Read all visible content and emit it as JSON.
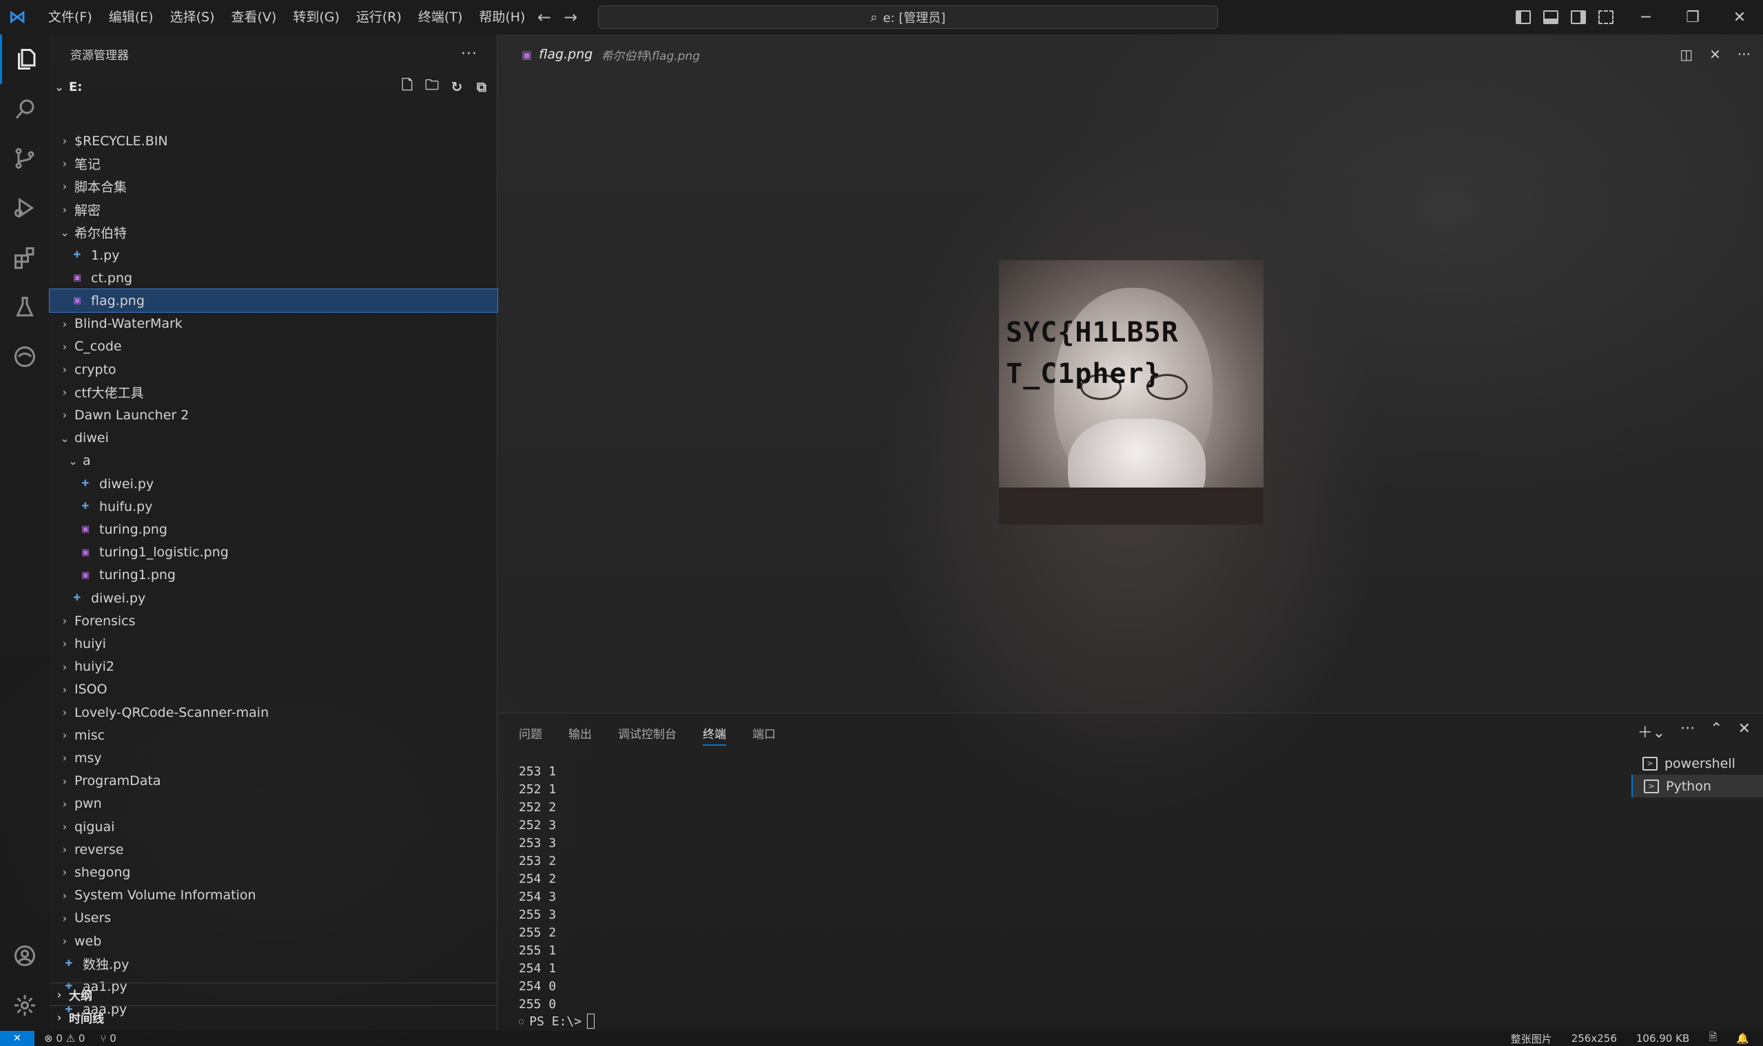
{
  "titlebar": {
    "menu": [
      "文件(F)",
      "编辑(E)",
      "选择(S)",
      "查看(V)",
      "转到(G)",
      "运行(R)",
      "终端(T)",
      "帮助(H)"
    ],
    "search_text": "e: [管理员]"
  },
  "explorer": {
    "title": "资源管理器",
    "root": "E:",
    "items": [
      {
        "label": "$RECYCLE.BIN",
        "type": "folder",
        "depth": 0,
        "expanded": false
      },
      {
        "label": "笔记",
        "type": "folder",
        "depth": 0,
        "expanded": false
      },
      {
        "label": "脚本合集",
        "type": "folder",
        "depth": 0,
        "expanded": false
      },
      {
        "label": "解密",
        "type": "folder",
        "depth": 0,
        "expanded": false
      },
      {
        "label": "希尔伯特",
        "type": "folder",
        "depth": 0,
        "expanded": true
      },
      {
        "label": "1.py",
        "type": "py",
        "depth": 1
      },
      {
        "label": "ct.png",
        "type": "img",
        "depth": 1
      },
      {
        "label": "flag.png",
        "type": "img",
        "depth": 1,
        "selected": true
      },
      {
        "label": "Blind-WaterMark",
        "type": "folder",
        "depth": 0,
        "expanded": false
      },
      {
        "label": "C_code",
        "type": "folder",
        "depth": 0,
        "expanded": false
      },
      {
        "label": "crypto",
        "type": "folder",
        "depth": 0,
        "expanded": false
      },
      {
        "label": "ctf大佬工具",
        "type": "folder",
        "depth": 0,
        "expanded": false
      },
      {
        "label": "Dawn Launcher 2",
        "type": "folder",
        "depth": 0,
        "expanded": false
      },
      {
        "label": "diwei",
        "type": "folder",
        "depth": 0,
        "expanded": true
      },
      {
        "label": "a",
        "type": "folder",
        "depth": 1,
        "expanded": true
      },
      {
        "label": "diwei.py",
        "type": "py",
        "depth": 2
      },
      {
        "label": "huifu.py",
        "type": "py",
        "depth": 2
      },
      {
        "label": "turing.png",
        "type": "img",
        "depth": 2
      },
      {
        "label": "turing1_logistic.png",
        "type": "img",
        "depth": 2
      },
      {
        "label": "turing1.png",
        "type": "img",
        "depth": 2
      },
      {
        "label": "diwei.py",
        "type": "py",
        "depth": 1
      },
      {
        "label": "Forensics",
        "type": "folder",
        "depth": 0,
        "expanded": false
      },
      {
        "label": "huiyi",
        "type": "folder",
        "depth": 0,
        "expanded": false
      },
      {
        "label": "huiyi2",
        "type": "folder",
        "depth": 0,
        "expanded": false
      },
      {
        "label": "ISOO",
        "type": "folder",
        "depth": 0,
        "expanded": false
      },
      {
        "label": "Lovely-QRCode-Scanner-main",
        "type": "folder",
        "depth": 0,
        "expanded": false
      },
      {
        "label": "misc",
        "type": "folder",
        "depth": 0,
        "expanded": false
      },
      {
        "label": "msy",
        "type": "folder",
        "depth": 0,
        "expanded": false
      },
      {
        "label": "ProgramData",
        "type": "folder",
        "depth": 0,
        "expanded": false
      },
      {
        "label": "pwn",
        "type": "folder",
        "depth": 0,
        "expanded": false
      },
      {
        "label": "qiguai",
        "type": "folder",
        "depth": 0,
        "expanded": false
      },
      {
        "label": "reverse",
        "type": "folder",
        "depth": 0,
        "expanded": false
      },
      {
        "label": "shegong",
        "type": "folder",
        "depth": 0,
        "expanded": false
      },
      {
        "label": "System Volume Information",
        "type": "folder",
        "depth": 0,
        "expanded": false
      },
      {
        "label": "Users",
        "type": "folder",
        "depth": 0,
        "expanded": false
      },
      {
        "label": "web",
        "type": "folder",
        "depth": 0,
        "expanded": false
      },
      {
        "label": "数独.py",
        "type": "py",
        "depth": 0
      },
      {
        "label": "aa1.py",
        "type": "py",
        "depth": 0
      },
      {
        "label": "aaa.py",
        "type": "py",
        "depth": 0
      }
    ],
    "outline_label": "大纲",
    "timeline_label": "时间线"
  },
  "editor": {
    "tab_name": "flag.png",
    "tab_path": "希尔伯特\\flag.png",
    "image_text_line1": "SYC{H1LB5R",
    "image_text_line2": "T_C1pher}"
  },
  "panel": {
    "tabs": [
      "问题",
      "输出",
      "调试控制台",
      "终端",
      "端口"
    ],
    "active_tab": "终端",
    "terminal_lines": [
      "253 1",
      "252 1",
      "252 2",
      "252 3",
      "253 3",
      "253 2",
      "254 2",
      "254 3",
      "255 3",
      "255 2",
      "255 1",
      "254 1",
      "254 0",
      "255 0"
    ],
    "prompt": "PS E:\\>",
    "terminals": [
      "powershell",
      "Python"
    ],
    "active_terminal": "Python"
  },
  "statusbar": {
    "errors": "0",
    "warnings": "0",
    "ports": "0",
    "image_mode": "整张图片",
    "dimensions": "256x256",
    "filesize": "106.90 KB"
  },
  "colors": {
    "accent": "#0078d4",
    "selection": "#1f3f66",
    "py_icon": "#5b9bd5",
    "img_icon": "#b36fd6"
  }
}
